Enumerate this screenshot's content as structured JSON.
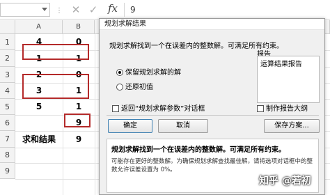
{
  "formula_bar": {
    "dots": "⋮",
    "cancel_icon": "✕",
    "enter_icon": "✓",
    "fx_label": "fx",
    "value": "9"
  },
  "sheet": {
    "columns": [
      "A",
      "B"
    ],
    "rows": [
      "1",
      "2",
      "3",
      "4",
      "5",
      "6",
      "7",
      "8",
      "9"
    ],
    "cells": {
      "a1": "4",
      "b1": "0",
      "a2": "1",
      "b2": "1",
      "a3": "2",
      "b3": "0",
      "a4": "3",
      "b4": "1",
      "a5": "5",
      "b5": "1",
      "b6": "9",
      "a7": "求和结果",
      "b7": "9"
    }
  },
  "dialog": {
    "title": "规划求解结果",
    "message": "规划求解找到一个在误差内的整数解。可满足所有约束。",
    "radio_keep": "保留规划求解的解",
    "radio_restore": "还原初值",
    "report_label": "报告",
    "report_items": [
      "运算结果报告"
    ],
    "checkbox_return": "返回“规划求解参数”对话框",
    "checkbox_outline": "制作报告大纲",
    "ok_label": "确定",
    "cancel_label": "取消",
    "save_scenario_label": "保存方案...",
    "info_bold": "规划求解找到一个在误差内的整数解。可满足所有约束。",
    "info_text": "可能存在更好的整数解。为确保规划求解查找最佳解，请将选项对话框中的整数允许误差设置为 0%。"
  },
  "watermark": "知乎 @若初"
}
